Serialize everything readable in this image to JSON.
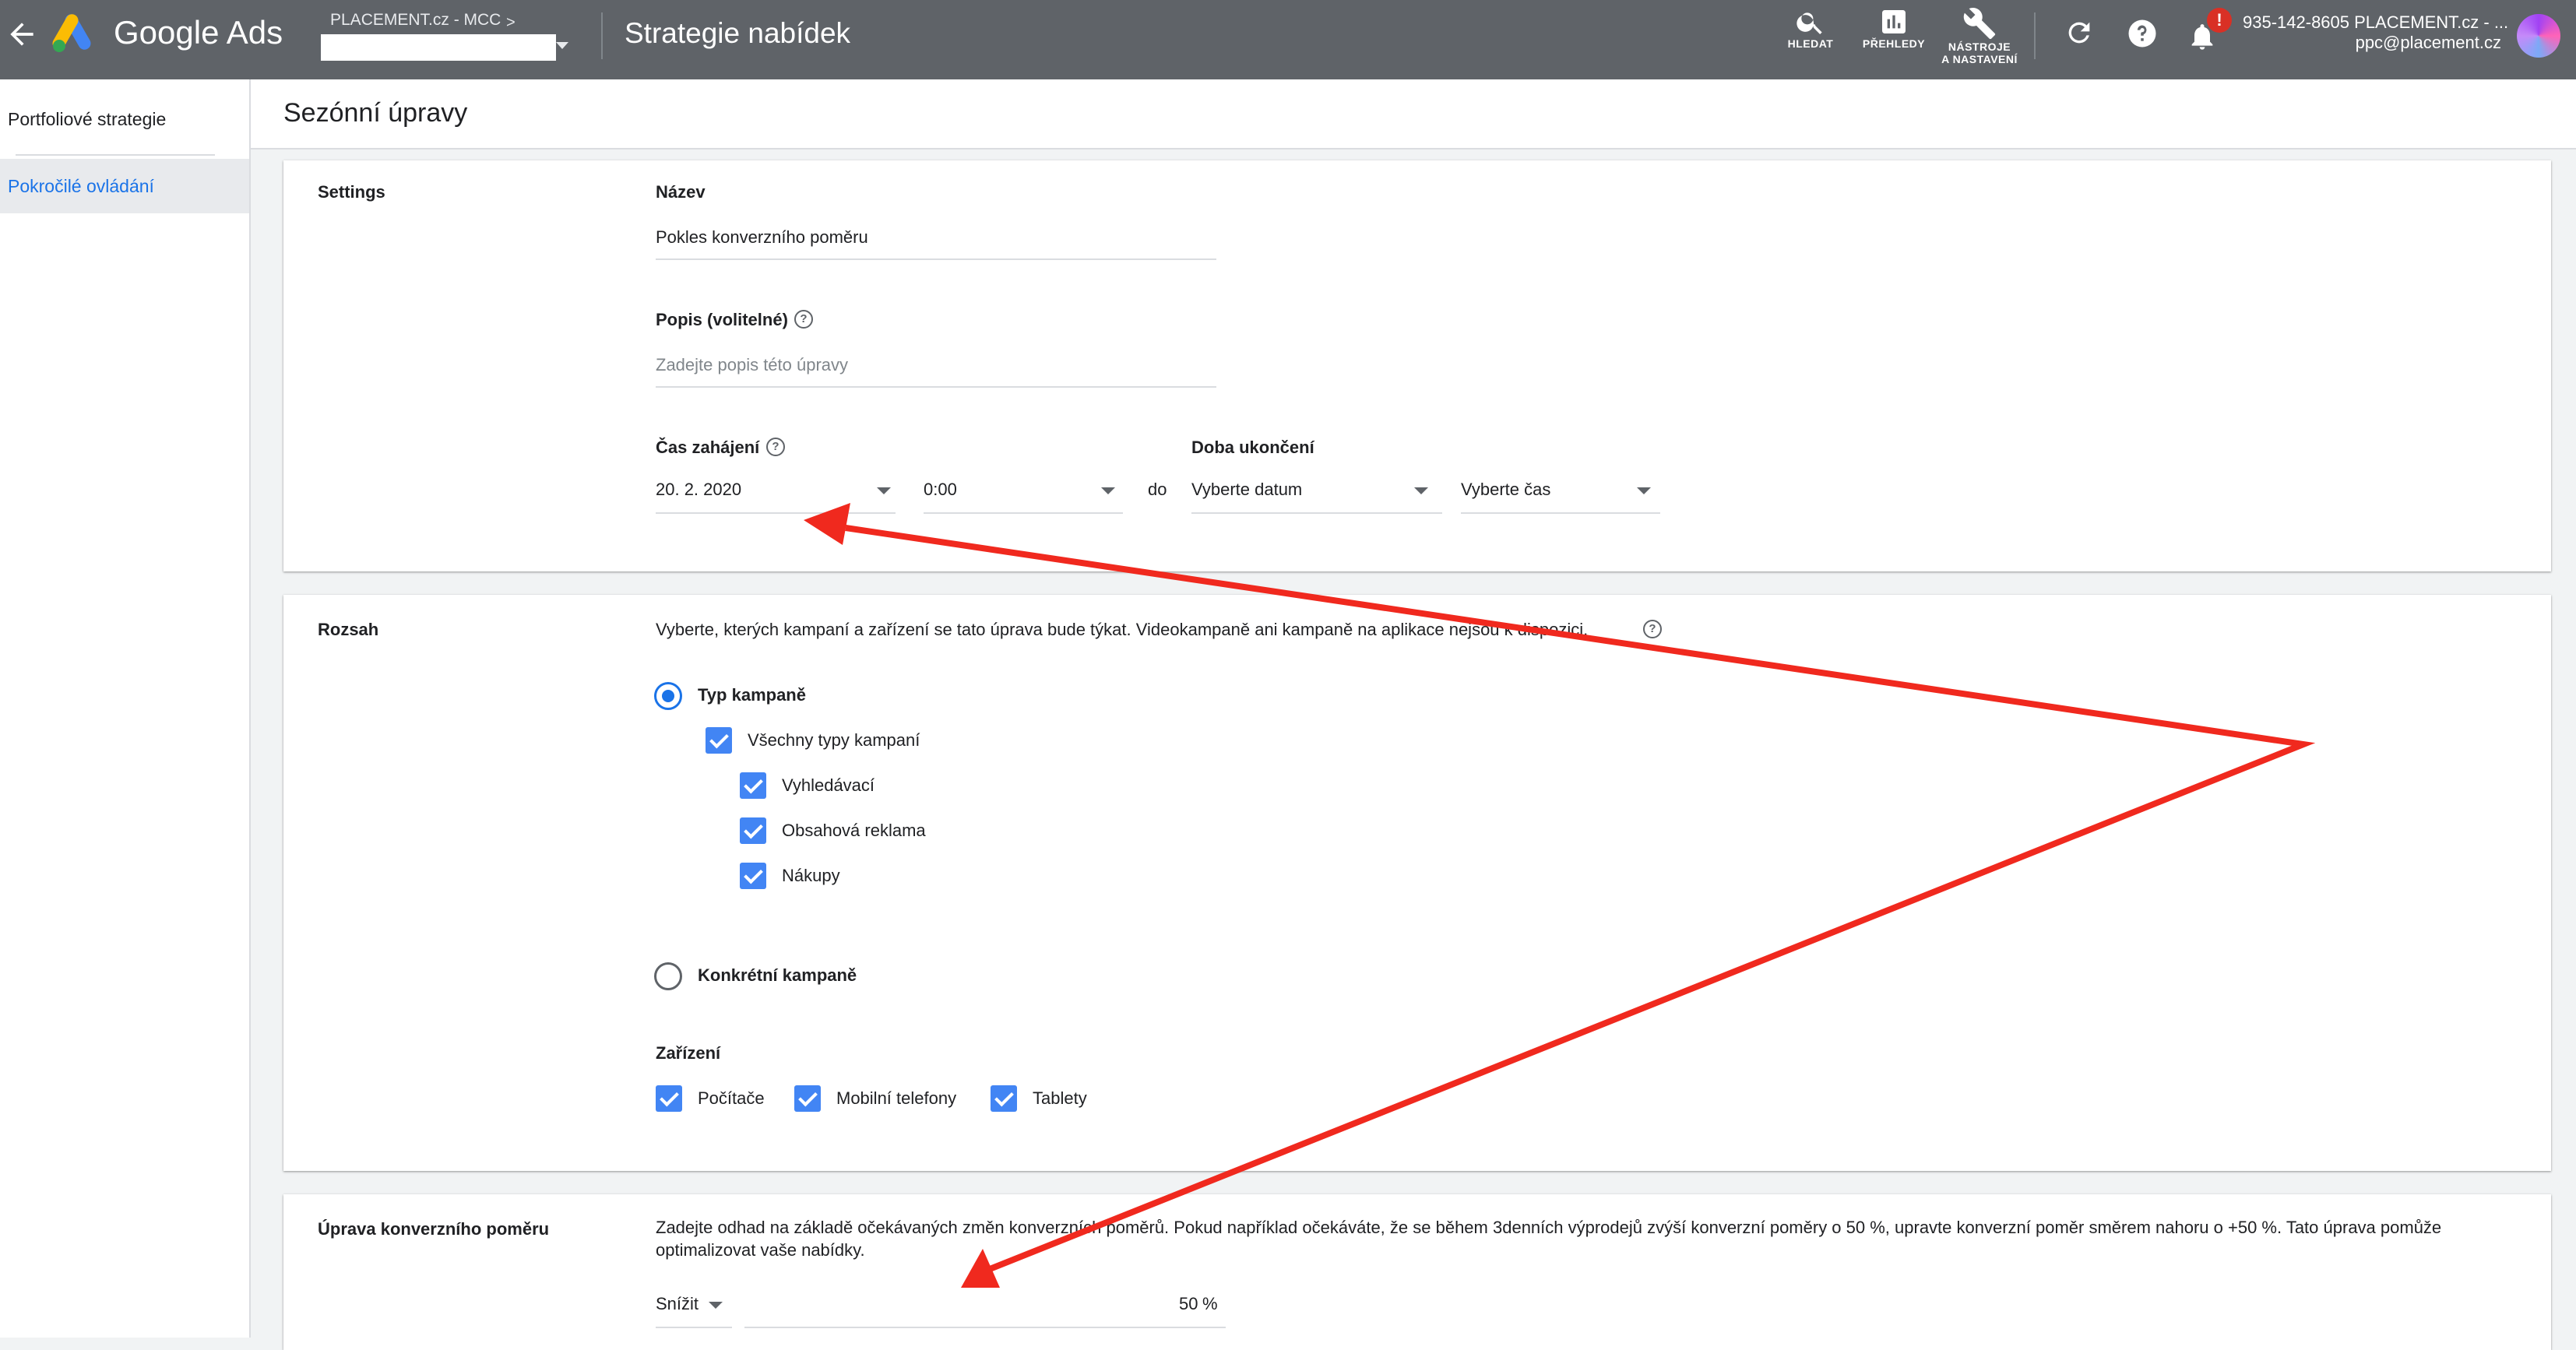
{
  "header": {
    "brand": "Google Ads",
    "account_path": "PLACEMENT.cz - MCC",
    "account_chevron": ">",
    "page_title": "Strategie nabídek",
    "tools": [
      {
        "label": "HLEDAT",
        "icon": "search-icon"
      },
      {
        "label": "PŘEHLEDY",
        "icon": "reports-icon"
      },
      {
        "label": "NÁSTROJE\nA NASTAVENÍ",
        "icon": "wrench-icon"
      }
    ],
    "notification_badge": "!",
    "account_id": "935-142-8605 PLACEMENT.cz - ...",
    "account_email": "ppc@placement.cz"
  },
  "sidebar": {
    "items": [
      {
        "label": "Portfoliové strategie",
        "active": false
      },
      {
        "label": "Pokročilé ovládání",
        "active": true
      }
    ]
  },
  "page": {
    "title": "Sezónní úpravy"
  },
  "settings": {
    "section_title": "Settings",
    "name_label": "Název",
    "name_value": "Pokles konverzního poměru",
    "desc_label": "Popis (volitelné)",
    "desc_placeholder": "Zadejte popis této úpravy",
    "start_label": "Čas zahájení",
    "start_date": "20. 2. 2020",
    "start_time": "0:00",
    "to_text": "do",
    "end_label": "Doba ukončení",
    "end_date_placeholder": "Vyberte datum",
    "end_time_placeholder": "Vyberte čas",
    "help_glyph": "?"
  },
  "scope": {
    "section_title": "Rozsah",
    "description": "Vyberte, kterých kampaní a zařízení se tato úprava bude týkat. Videokampaně ani kampaně na aplikace nejsou k dispozici.",
    "option_campaign_type": "Typ kampaně",
    "all_types": "Všechny typy kampaní",
    "types": [
      "Vyhledávací",
      "Obsahová reklama",
      "Nákupy"
    ],
    "option_specific": "Konkrétní kampaně",
    "devices_label": "Zařízení",
    "devices": [
      "Počítače",
      "Mobilní telefony",
      "Tablety"
    ]
  },
  "conversion": {
    "section_title": "Úprava konverzního poměru",
    "description": "Zadejte odhad na základě očekávaných změn konverzních poměrů. Pokud například očekáváte, že se během 3denních výprodejů zvýší konverzní poměry o 50 %, upravte konverzní poměr směrem nahoru o +50 %. Tato úprava pomůže optimalizovat vaše nabídky.",
    "direction": "Snížit",
    "value": "50",
    "unit": "%"
  },
  "colors": {
    "header_bg": "#5f6368",
    "accent_blue": "#1a73e8",
    "checkbox_blue": "#4285f4",
    "annotation_red": "#f0291e"
  }
}
